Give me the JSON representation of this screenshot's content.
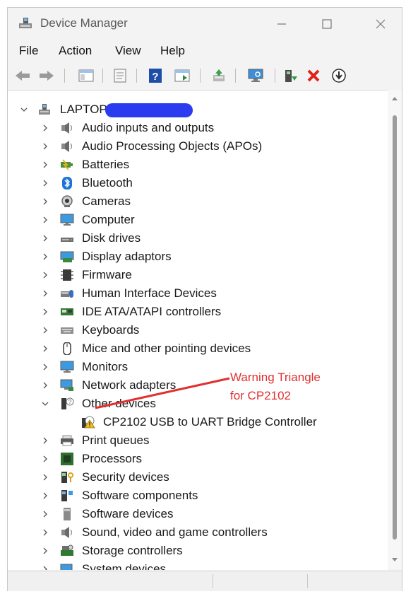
{
  "window": {
    "title": "Device Manager",
    "minimize_icon": "minimize-icon",
    "maximize_icon": "maximize-icon",
    "close_icon": "close-icon"
  },
  "menu": [
    "File",
    "Action",
    "View",
    "Help"
  ],
  "toolbar": {
    "buttons": [
      "back-arrow-icon",
      "forward-arrow-icon",
      "show-hide-console-tree-icon",
      "properties-icon",
      "help-icon",
      "run-action-icon",
      "update-driver-icon",
      "scan-hardware-icon",
      "enable-device-icon",
      "uninstall-device-icon",
      "disable-device-icon"
    ]
  },
  "tree": {
    "root": "LAPTOP",
    "root_redaction_color": "#2a3bf0",
    "categories": [
      {
        "label": "Audio inputs and outputs",
        "icon": "speaker-icon",
        "expanded": false
      },
      {
        "label": "Audio Processing Objects (APOs)",
        "icon": "speaker-icon",
        "expanded": false
      },
      {
        "label": "Batteries",
        "icon": "battery-icon",
        "expanded": false
      },
      {
        "label": "Bluetooth",
        "icon": "bluetooth-icon",
        "expanded": false
      },
      {
        "label": "Cameras",
        "icon": "camera-icon",
        "expanded": false
      },
      {
        "label": "Computer",
        "icon": "computer-icon",
        "expanded": false
      },
      {
        "label": "Disk drives",
        "icon": "disk-drive-icon",
        "expanded": false
      },
      {
        "label": "Display adaptors",
        "icon": "display-adapter-icon",
        "expanded": false
      },
      {
        "label": "Firmware",
        "icon": "firmware-icon",
        "expanded": false
      },
      {
        "label": "Human Interface Devices",
        "icon": "hid-icon",
        "expanded": false
      },
      {
        "label": "IDE ATA/ATAPI controllers",
        "icon": "ide-controller-icon",
        "expanded": false
      },
      {
        "label": "Keyboards",
        "icon": "keyboard-icon",
        "expanded": false
      },
      {
        "label": "Mice and other pointing devices",
        "icon": "mouse-icon",
        "expanded": false
      },
      {
        "label": "Monitors",
        "icon": "monitor-icon",
        "expanded": false
      },
      {
        "label": "Network adapters",
        "icon": "network-adapter-icon",
        "expanded": false
      },
      {
        "label": "Other devices",
        "icon": "unknown-device-icon",
        "expanded": true,
        "children": [
          {
            "label": "CP2102 USB to UART Bridge Controller",
            "icon": "warning-device-icon"
          }
        ]
      },
      {
        "label": "Print queues",
        "icon": "printer-icon",
        "expanded": false
      },
      {
        "label": "Processors",
        "icon": "processor-icon",
        "expanded": false
      },
      {
        "label": "Security devices",
        "icon": "security-device-icon",
        "expanded": false
      },
      {
        "label": "Software components",
        "icon": "software-component-icon",
        "expanded": false
      },
      {
        "label": "Software devices",
        "icon": "software-device-icon",
        "expanded": false
      },
      {
        "label": "Sound, video and game controllers",
        "icon": "speaker-icon",
        "expanded": false
      },
      {
        "label": "Storage controllers",
        "icon": "storage-controller-icon",
        "expanded": false
      },
      {
        "label": "System devices",
        "icon": "system-device-icon",
        "expanded": false
      }
    ]
  },
  "annotation": {
    "line1": "Warning Triangle",
    "line2": "for CP2102",
    "color": "#e03030"
  }
}
